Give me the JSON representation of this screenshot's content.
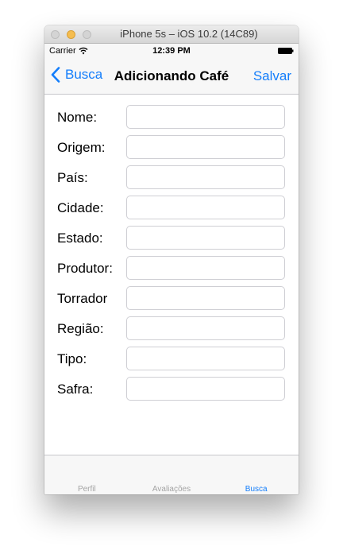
{
  "window": {
    "title": "iPhone 5s – iOS 10.2 (14C89)"
  },
  "status_bar": {
    "carrier": "Carrier",
    "time": "12:39 PM",
    "icons": [
      "wifi-icon",
      "battery-icon"
    ]
  },
  "nav": {
    "back_label": "Busca",
    "title": "Adicionando Café",
    "save_label": "Salvar"
  },
  "form": {
    "fields": [
      {
        "label": "Nome:",
        "value": "",
        "placeholder": ""
      },
      {
        "label": "Origem:",
        "value": "",
        "placeholder": ""
      },
      {
        "label": "País:",
        "value": "",
        "placeholder": ""
      },
      {
        "label": "Cidade:",
        "value": "",
        "placeholder": ""
      },
      {
        "label": "Estado:",
        "value": "",
        "placeholder": ""
      },
      {
        "label": "Produtor:",
        "value": "",
        "placeholder": ""
      },
      {
        "label": "Torrador",
        "value": "",
        "placeholder": ""
      },
      {
        "label": "Região:",
        "value": "",
        "placeholder": ""
      },
      {
        "label": "Tipo:",
        "value": "",
        "placeholder": ""
      },
      {
        "label": "Safra:",
        "value": "",
        "placeholder": ""
      }
    ]
  },
  "tabs": [
    {
      "label": "Perfil",
      "active": false
    },
    {
      "label": "Avaliações",
      "active": false
    },
    {
      "label": "Busca",
      "active": true
    }
  ],
  "colors": {
    "accent": "#147efb",
    "inactive_tab": "#a4a4a4",
    "bar_background": "#f7f7f7"
  }
}
